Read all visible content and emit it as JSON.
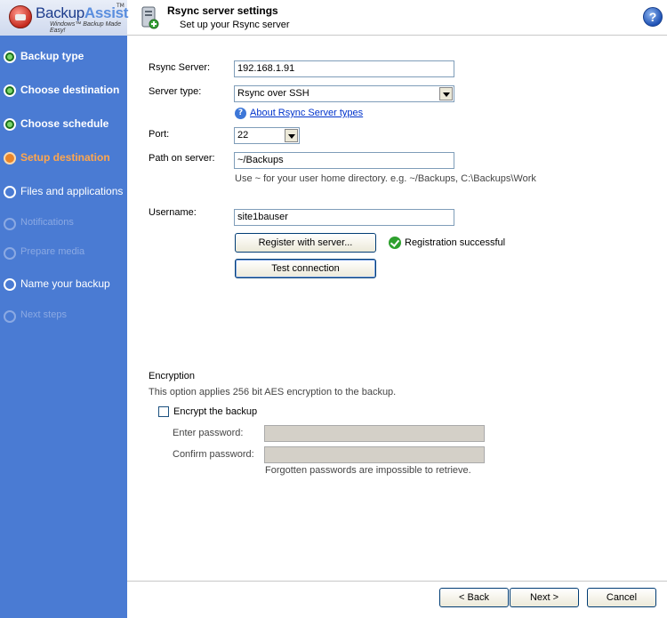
{
  "app": {
    "brand_a": "Backup",
    "brand_b": "Assist",
    "tagline": "Windows™ Backup Made Easy!",
    "trademark": "TM"
  },
  "header": {
    "title": "Rsync server settings",
    "subtitle": "Set up your Rsync server",
    "help_glyph": "?"
  },
  "sidebar": {
    "items": [
      {
        "label": "Backup type",
        "state": "done"
      },
      {
        "label": "Choose destination",
        "state": "done"
      },
      {
        "label": "Choose schedule",
        "state": "done"
      },
      {
        "label": "Setup destination",
        "state": "current"
      },
      {
        "label": "Files and applications",
        "state": "todo"
      },
      {
        "label": "Notifications",
        "state": "disabled"
      },
      {
        "label": "Prepare media",
        "state": "disabled"
      },
      {
        "label": "Name your backup",
        "state": "todo"
      },
      {
        "label": "Next steps",
        "state": "disabled"
      }
    ]
  },
  "form": {
    "rsync_server_label": "Rsync Server:",
    "rsync_server_value": "192.168.1.91",
    "server_type_label": "Server type:",
    "server_type_value": "Rsync over SSH",
    "about_link": "About Rsync Server types",
    "port_label": "Port:",
    "port_value": "22",
    "path_label": "Path on server:",
    "path_value": "~/Backups",
    "path_hint": "Use ~ for your user home directory. e.g. ~/Backups, C:\\Backups\\Work",
    "username_label": "Username:",
    "username_value": "site1bauser",
    "register_button": "Register with server...",
    "registration_status": "Registration successful",
    "test_button": "Test connection"
  },
  "encryption": {
    "heading": "Encryption",
    "description": "This option applies 256 bit AES encryption to the backup.",
    "encrypt_label": "Encrypt the backup",
    "encrypt_checked": false,
    "enter_password_label": "Enter password:",
    "confirm_password_label": "Confirm password:",
    "warning": "Forgotten passwords are impossible to retrieve."
  },
  "footer": {
    "back_button": "< Back",
    "next_button": "Next >",
    "cancel_button": "Cancel"
  },
  "colors": {
    "sidebar_bg": "#4a7bd3",
    "current_step": "#ffa64d",
    "done_step": "#2a9d2a",
    "link": "#0033cc"
  }
}
